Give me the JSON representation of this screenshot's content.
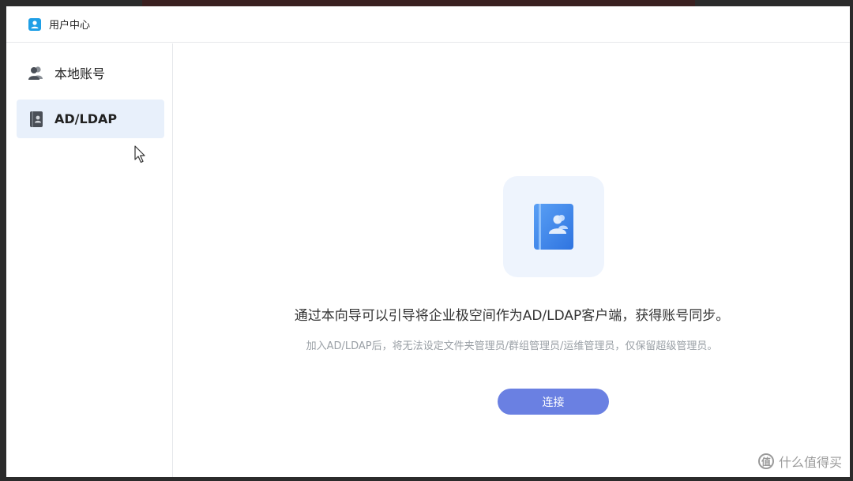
{
  "window": {
    "title": "用户中心"
  },
  "sidebar": {
    "items": [
      {
        "label": "本地账号",
        "icon": "users-icon",
        "active": false
      },
      {
        "label": "AD/LDAP",
        "icon": "address-book-icon",
        "active": true
      }
    ]
  },
  "main": {
    "icon": "address-book-icon",
    "description": "通过本向导可以引导将企业极空间作为AD/LDAP客户端，获得账号同步。",
    "note": "加入AD/LDAP后，将无法设定文件夹管理员/群组管理员/运维管理员，仅保留超级管理员。",
    "connect_label": "连接"
  },
  "watermark": {
    "text": "什么值得买",
    "badge": "值"
  },
  "colors": {
    "accent": "#6a80e2",
    "active_bg": "#e8f0fb",
    "icon_blue": "#4a8ff0"
  }
}
